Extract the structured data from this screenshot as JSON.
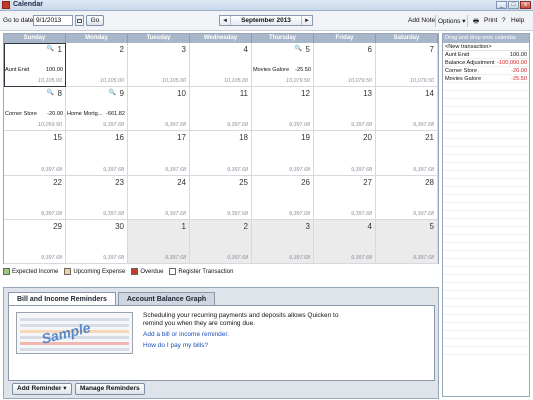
{
  "window": {
    "title": "Calendar",
    "buttons": {
      "minimize": "_",
      "maximize": "□",
      "close": "x"
    }
  },
  "toolbar": {
    "goto_label": "Go to date",
    "date_value": "9/1/2013",
    "go_label": "Go",
    "prev_arrow": "◄",
    "month_label": "September 2013",
    "next_arrow": "►",
    "add_note_label": "Add Note",
    "options_label": "Options ▾",
    "print_label": "Print",
    "help_label": "Help"
  },
  "calendar": {
    "weekdays": [
      "Sunday",
      "Monday",
      "Tuesday",
      "Wednesday",
      "Thursday",
      "Friday",
      "Saturday"
    ],
    "weeks": [
      [
        {
          "day": "1",
          "zoom": true,
          "selected": true,
          "tx": [
            {
              "name": "Aunt Enid",
              "amount": "100.00"
            }
          ],
          "balance": "10,105.00"
        },
        {
          "day": "2",
          "balance": "10,105.00"
        },
        {
          "day": "3",
          "balance": "10,105.00"
        },
        {
          "day": "4",
          "balance": "10,105.00"
        },
        {
          "day": "5",
          "zoom": true,
          "tx": [
            {
              "name": "Movies Galore",
              "amount": "-25.50"
            }
          ],
          "balance": "10,079.50"
        },
        {
          "day": "6",
          "balance": "10,079.50"
        },
        {
          "day": "7",
          "balance": "10,079.50"
        }
      ],
      [
        {
          "day": "8",
          "zoom": true,
          "tx": [
            {
              "name": "Corner Store",
              "amount": "-20.00"
            }
          ],
          "balance": "10,059.50"
        },
        {
          "day": "9",
          "zoom": true,
          "tx": [
            {
              "name": "Home Mortg...",
              "amount": "-661.82"
            }
          ],
          "balance": "9,397.68"
        },
        {
          "day": "10",
          "balance": "9,397.68"
        },
        {
          "day": "11",
          "balance": "9,397.68"
        },
        {
          "day": "12",
          "balance": "9,397.68"
        },
        {
          "day": "13",
          "balance": "9,397.68"
        },
        {
          "day": "14",
          "balance": "9,397.68"
        }
      ],
      [
        {
          "day": "15",
          "balance": "9,397.68"
        },
        {
          "day": "16",
          "balance": "9,397.68"
        },
        {
          "day": "17",
          "balance": "9,397.68"
        },
        {
          "day": "18",
          "balance": "9,397.68"
        },
        {
          "day": "19",
          "balance": "9,397.68"
        },
        {
          "day": "20",
          "balance": "9,397.68"
        },
        {
          "day": "21",
          "balance": "9,397.68"
        }
      ],
      [
        {
          "day": "22",
          "balance": "9,397.68"
        },
        {
          "day": "23",
          "balance": "9,397.68"
        },
        {
          "day": "24",
          "balance": "9,397.68"
        },
        {
          "day": "25",
          "balance": "9,397.68"
        },
        {
          "day": "26",
          "balance": "9,397.68"
        },
        {
          "day": "27",
          "balance": "9,397.68"
        },
        {
          "day": "28",
          "balance": "9,397.68"
        }
      ],
      [
        {
          "day": "29",
          "balance": "9,397.68"
        },
        {
          "day": "30",
          "balance": "9,397.68"
        },
        {
          "day": "1",
          "other": true,
          "balance": "9,397.68"
        },
        {
          "day": "2",
          "other": true,
          "balance": "9,397.68"
        },
        {
          "day": "3",
          "other": true,
          "balance": "9,397.68"
        },
        {
          "day": "4",
          "other": true,
          "balance": "9,397.68"
        },
        {
          "day": "5",
          "other": true,
          "balance": "9,397.68"
        }
      ]
    ]
  },
  "legend": [
    {
      "label": "Expected Income",
      "color": "#9cc97a"
    },
    {
      "label": "Upcoming Expense",
      "color": "#f3cf9c"
    },
    {
      "label": "Overdue",
      "color": "#c0402a"
    },
    {
      "label": "Register Transaction",
      "color": "#ffffff"
    }
  ],
  "reminders": {
    "tabs": [
      "Bill and Income Reminders",
      "Account Balance Graph"
    ],
    "sample_word": "Sample",
    "description": "Scheduling your recurring payments and deposits allows Quicken to remind you when they are coming due.",
    "link_add": "Add a bill or income reminder.",
    "link_how": "How do I pay my bills?",
    "add_reminder_label": "Add Reminder ▾",
    "manage_label": "Manage Reminders"
  },
  "sidepanel": {
    "header": "Drag and drop onto calendar",
    "new_item": "<New transaction>",
    "items": [
      {
        "name": "Aunt Enid",
        "amount": "100.00",
        "negative": false
      },
      {
        "name": "Balance Adjustment",
        "amount": "-100,000.00",
        "negative": true
      },
      {
        "name": "Corner Store",
        "amount": "-20.00",
        "negative": true
      },
      {
        "name": "Movies Galore",
        "amount": "-25.50",
        "negative": true
      }
    ]
  }
}
